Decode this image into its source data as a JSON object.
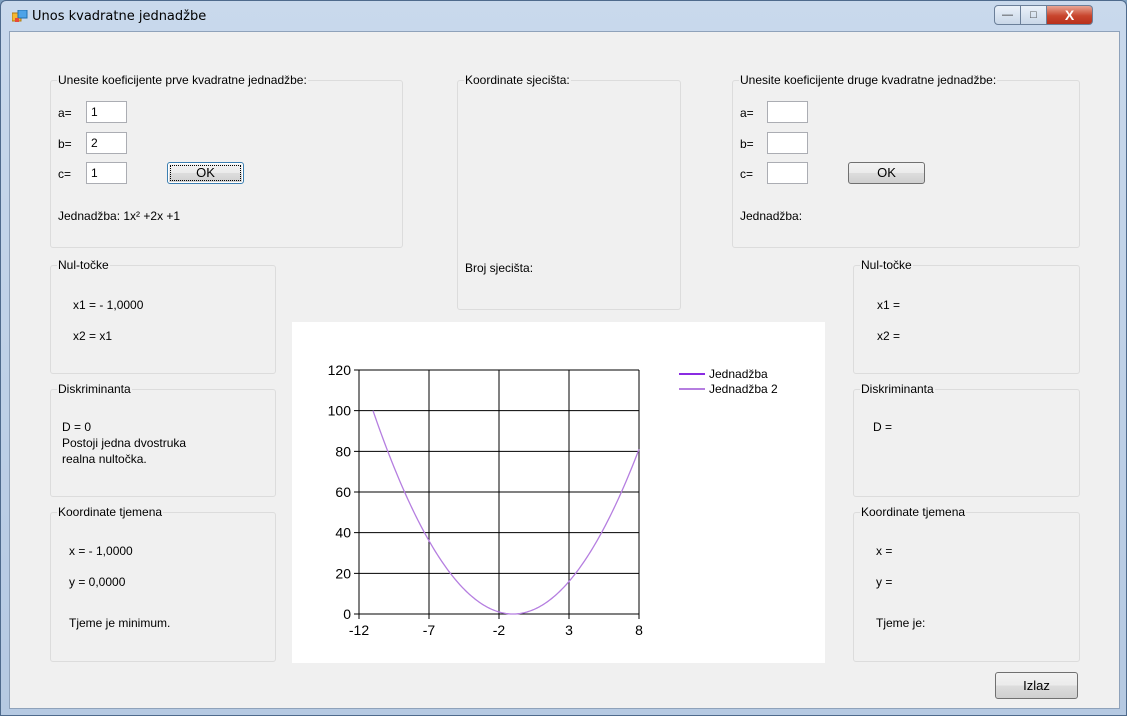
{
  "window": {
    "title": "Unos kvadratne jednadžbe",
    "min_glyph": "—",
    "max_glyph": "□",
    "close_glyph": "X"
  },
  "left": {
    "coef_group_title": "Unesite koeficijente prve kvadratne jednadžbe:",
    "a_label": "a=",
    "a_value": "1",
    "b_label": "b=",
    "b_value": "2",
    "c_label": "c=",
    "c_value": "1",
    "ok_label": "OK",
    "equation_text": "Jednadžba: 1x² +2x +1",
    "roots_title": "Nul-točke",
    "x1_text": "x1 = - 1,0000",
    "x2_text": "x2 = x1",
    "disc_title": "Diskriminanta",
    "disc_text": "D = 0",
    "disc_note_1": "Postoji jedna dvostruka",
    "disc_note_2": "realna nultočka.",
    "vertex_title": "Koordinate tjemena",
    "vx_text": "x = - 1,0000",
    "vy_text": "y = 0,0000",
    "vertex_type": "Tjeme je minimum."
  },
  "middle": {
    "intersect_title": "Koordinate sjecišta:",
    "count_label": "Broj sjecišta:"
  },
  "right": {
    "coef_group_title": "Unesite koeficijente druge kvadratne jednadžbe:",
    "a_label": "a=",
    "a_value": "",
    "b_label": "b=",
    "b_value": "",
    "c_label": "c=",
    "c_value": "",
    "ok_label": "OK",
    "equation_text": "Jednadžba:",
    "roots_title": "Nul-točke",
    "x1_text": "x1 =",
    "x2_text": "x2 =",
    "disc_title": "Diskriminanta",
    "disc_text": "D =",
    "vertex_title": "Koordinate tjemena",
    "vx_text": "x =",
    "vy_text": "y =",
    "vertex_type": "Tjeme je:"
  },
  "exit_label": "Izlaz",
  "chart_data": {
    "type": "line",
    "title": "",
    "xlabel": "",
    "ylabel": "",
    "xlim": [
      -12,
      8
    ],
    "ylim": [
      0,
      120
    ],
    "x_ticks": [
      -12,
      -7,
      -2,
      3,
      8
    ],
    "y_ticks": [
      0,
      20,
      40,
      60,
      80,
      100,
      120
    ],
    "grid": true,
    "legend_position": "top-right",
    "series": [
      {
        "name": "Jednadžba",
        "color": "#b57ee0",
        "x": [
          -11,
          -10,
          -9,
          -8,
          -7,
          -6,
          -5,
          -4,
          -3,
          -2,
          -1,
          0,
          1,
          2,
          3,
          4,
          5,
          6,
          7,
          8
        ],
        "y": [
          100,
          81,
          64,
          49,
          36,
          25,
          16,
          9,
          4,
          1,
          0,
          1,
          4,
          9,
          16,
          25,
          36,
          49,
          64,
          81
        ]
      },
      {
        "name": "Jednadžba 2",
        "color": "#b57ee0",
        "x": [],
        "y": []
      }
    ],
    "legend_colors": [
      "#8a2be2",
      "#b57ee0"
    ]
  }
}
